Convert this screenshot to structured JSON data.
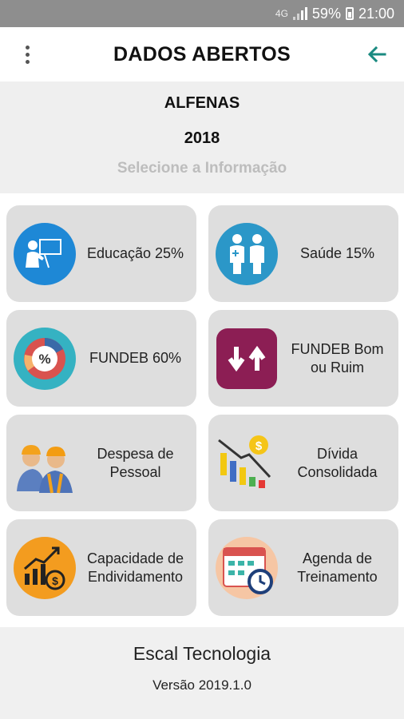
{
  "status_bar": {
    "network": "4G",
    "battery": "59%",
    "time": "21:00"
  },
  "app_bar": {
    "title": "DADOS ABERTOS",
    "menu_icon": "more-vert-icon",
    "back_icon": "arrow-left-icon",
    "accent": "#1a8a80"
  },
  "header": {
    "city": "ALFENAS",
    "year": "2018",
    "hint": "Selecione a Informação"
  },
  "cards": [
    {
      "label": "Educação 25%",
      "icon": "teacher-icon"
    },
    {
      "label": "Saúde 15%",
      "icon": "doctors-icon"
    },
    {
      "label": "FUNDEB 60%",
      "icon": "percent-chart-icon"
    },
    {
      "label": "FUNDEB Bom\nou Ruim",
      "icon": "up-down-arrows-icon"
    },
    {
      "label": "Despesa de\nPessoal",
      "icon": "workers-icon"
    },
    {
      "label": "Dívida\nConsolidada",
      "icon": "debt-chart-icon"
    },
    {
      "label": "Capacidade de\nEndividamento",
      "icon": "growth-money-icon"
    },
    {
      "label": "Agenda de\nTreinamento",
      "icon": "calendar-clock-icon"
    }
  ],
  "footer": {
    "company": "Escal Tecnologia",
    "version": "Versão 2019.1.0"
  }
}
